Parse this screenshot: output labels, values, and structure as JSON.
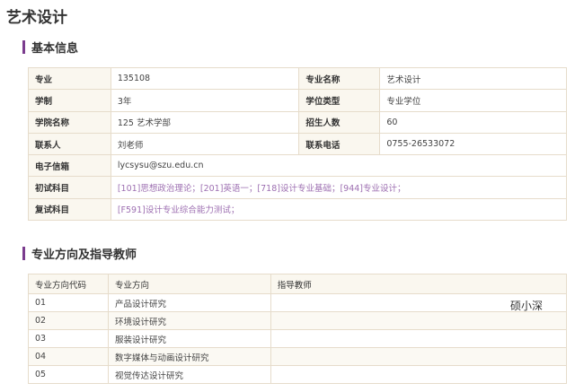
{
  "page": {
    "title": "艺术设计"
  },
  "basic": {
    "heading": "基本信息",
    "rows": [
      [
        "专业",
        "135108",
        "专业名称",
        "艺术设计"
      ],
      [
        "学制",
        "3年",
        "学位类型",
        "专业学位"
      ],
      [
        "学院名称",
        "125 艺术学部",
        "招生人数",
        "60"
      ],
      [
        "联系人",
        "刘老师",
        "联系电话",
        "0755-26533072"
      ]
    ],
    "email": {
      "label": "电子信箱",
      "value": "lycsysu@szu.edu.cn"
    },
    "initial_exam": {
      "label": "初试科目",
      "value": "[101]思想政治理论；[201]英语一；[718]设计专业基础；[944]专业设计；"
    },
    "retest": {
      "label": "复试科目",
      "value": "[F591]设计专业综合能力测试；"
    }
  },
  "directions": {
    "heading": "专业方向及指导教师",
    "columns": [
      "专业方向代码",
      "专业方向",
      "指导教师"
    ],
    "rows": [
      [
        "01",
        "产品设计研究",
        ""
      ],
      [
        "02",
        "环境设计研究",
        ""
      ],
      [
        "03",
        "服装设计研究",
        ""
      ],
      [
        "04",
        "数字媒体与动画设计研究",
        ""
      ],
      [
        "05",
        "视觉传达设计研究",
        ""
      ]
    ]
  },
  "watermark": "硕小深",
  "colors": {
    "accent": "#7b3c8e",
    "link": "#9d6fb1",
    "label_bg": "#faf7ef",
    "border": "#e6dccb"
  }
}
